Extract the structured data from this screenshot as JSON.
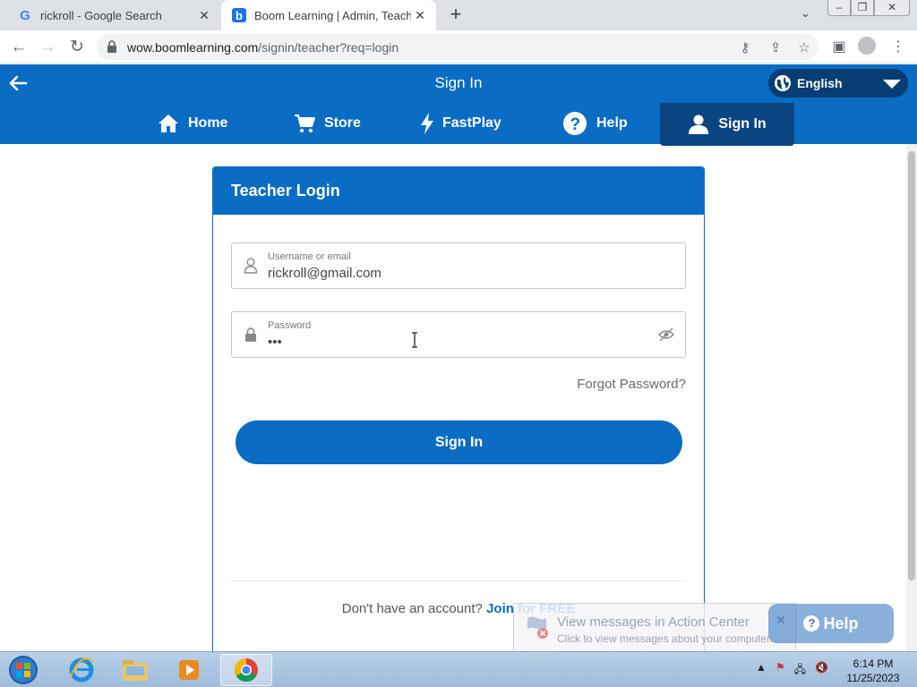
{
  "browser": {
    "tabs": [
      {
        "title": "rickroll - Google Search",
        "favicon": "google-g-icon"
      },
      {
        "title": "Boom Learning | Admin, Teacher",
        "favicon": "boom-b-icon"
      }
    ],
    "url_domain": "wow.boomlearning.com",
    "url_path": "/signin/teacher?req=login"
  },
  "site": {
    "page_title": "Sign In",
    "language": "English",
    "nav": [
      {
        "label": "Home",
        "icon": "home-icon"
      },
      {
        "label": "Store",
        "icon": "cart-icon"
      },
      {
        "label": "FastPlay",
        "icon": "lightning-icon"
      },
      {
        "label": "Help",
        "icon": "help-circle-icon"
      },
      {
        "label": "Sign In",
        "icon": "user-icon",
        "active": true
      }
    ],
    "accent": "#0a6cc3"
  },
  "login": {
    "heading": "Teacher Login",
    "username_label": "Username or email",
    "username_value": "rickroll@gmail.com",
    "password_label": "Password",
    "password_value": "•••",
    "forgot": "Forgot Password?",
    "submit": "Sign In",
    "signup_prompt": "Don't have an account?",
    "signup_link": "Join for FREE"
  },
  "help_widget": {
    "label": "Help"
  },
  "notification": {
    "title": "View messages in Action Center",
    "body": "Click to view messages about your computer."
  },
  "taskbar": {
    "time": "6:14 PM",
    "date": "11/25/2023"
  }
}
